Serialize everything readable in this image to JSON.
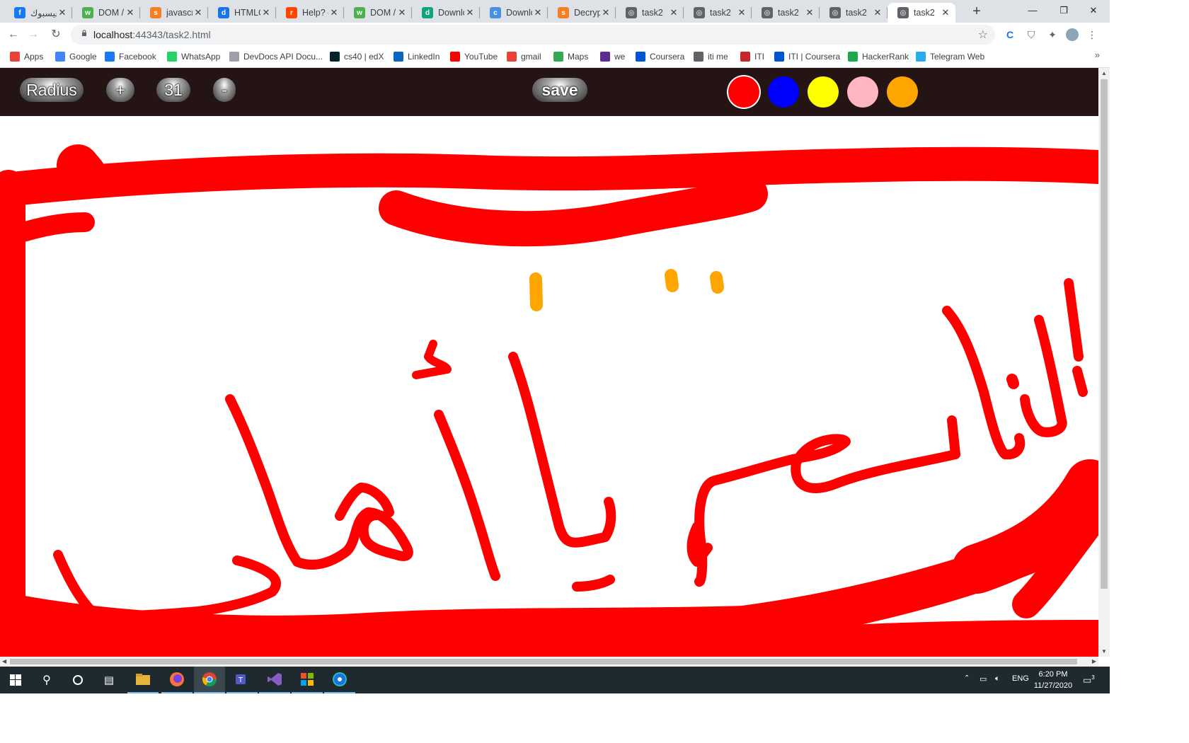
{
  "browser": {
    "tabs": [
      {
        "title": "فيسبوك",
        "icon": "facebook-icon",
        "color": "#1877f2",
        "glyph": "f"
      },
      {
        "title": "DOM /",
        "icon": "w3-icon",
        "color": "#4caf50",
        "glyph": "w"
      },
      {
        "title": "javascri",
        "icon": "stackoverflow-icon",
        "color": "#f48024",
        "glyph": "s"
      },
      {
        "title": "HTMLC",
        "icon": "devdocs-icon",
        "color": "#1a73e8",
        "glyph": "d"
      },
      {
        "title": "Help? c",
        "icon": "reddit-icon",
        "color": "#ff4500",
        "glyph": "r"
      },
      {
        "title": "DOM /",
        "icon": "w3-icon",
        "color": "#4caf50",
        "glyph": "w"
      },
      {
        "title": "Downlo",
        "icon": "download-icon",
        "color": "#10a37f",
        "glyph": "d"
      },
      {
        "title": "Downlo",
        "icon": "cloud-icon",
        "color": "#4a90e2",
        "glyph": "c"
      },
      {
        "title": "Decryp",
        "icon": "stackoverflow-icon",
        "color": "#f48024",
        "glyph": "s"
      },
      {
        "title": "task2",
        "icon": "globe-icon",
        "color": "#5f6368",
        "glyph": "◎"
      },
      {
        "title": "task2",
        "icon": "globe-icon",
        "color": "#5f6368",
        "glyph": "◎"
      },
      {
        "title": "task2",
        "icon": "globe-icon",
        "color": "#5f6368",
        "glyph": "◎"
      },
      {
        "title": "task2",
        "icon": "globe-icon",
        "color": "#5f6368",
        "glyph": "◎"
      },
      {
        "title": "task2",
        "icon": "globe-icon",
        "color": "#5f6368",
        "glyph": "◎",
        "active": true
      }
    ],
    "url_host": "localhost",
    "url_rest": ":44343/task2.html",
    "bookmarks": [
      {
        "label": "Apps",
        "icon": "apps-grid-icon",
        "color": "#ea4335"
      },
      {
        "label": "Google",
        "icon": "google-icon",
        "color": "#4285f4"
      },
      {
        "label": "Facebook",
        "icon": "facebook-icon",
        "color": "#1877f2"
      },
      {
        "label": "WhatsApp",
        "icon": "whatsapp-icon",
        "color": "#25d366"
      },
      {
        "label": "DevDocs API Docu...",
        "icon": "devdocs-icon",
        "color": "#9aa0a6"
      },
      {
        "label": "cs40 | edX",
        "icon": "edx-icon",
        "color": "#02262b"
      },
      {
        "label": "LinkedIn",
        "icon": "linkedin-icon",
        "color": "#0a66c2"
      },
      {
        "label": "YouTube",
        "icon": "youtube-icon",
        "color": "#ff0000"
      },
      {
        "label": "gmail",
        "icon": "gmail-icon",
        "color": "#ea4335"
      },
      {
        "label": "Maps",
        "icon": "maps-icon",
        "color": "#34a853"
      },
      {
        "label": "we",
        "icon": "we-icon",
        "color": "#5c2d91"
      },
      {
        "label": "Coursera",
        "icon": "coursera-icon",
        "color": "#0056d2"
      },
      {
        "label": "iti me",
        "icon": "globe-icon",
        "color": "#5f6368"
      },
      {
        "label": "ITI",
        "icon": "iti-icon",
        "color": "#c62828"
      },
      {
        "label": "ITI | Coursera",
        "icon": "coursera-icon",
        "color": "#0056d2"
      },
      {
        "label": "HackerRank",
        "icon": "hackerrank-icon",
        "color": "#1ba94c"
      },
      {
        "label": "Telegram Web",
        "icon": "telegram-icon",
        "color": "#2aabee"
      }
    ]
  },
  "app": {
    "radius_label": "Radius",
    "plus_label": "+",
    "radius_value": "31",
    "minus_label": "-",
    "save_label": "save",
    "header_bg": "#251414",
    "colors": [
      {
        "name": "red",
        "hex": "#ff0000",
        "selected": true
      },
      {
        "name": "blue",
        "hex": "#0000ff"
      },
      {
        "name": "yellow",
        "hex": "#ffff00"
      },
      {
        "name": "pink",
        "hex": "#ffb6c1"
      },
      {
        "name": "orange",
        "hex": "#ffa500"
      }
    ],
    "stroke_color": "#ff0000",
    "accent_stroke_color": "#ffa500"
  },
  "taskbar": {
    "apps": [
      "windows-start-icon",
      "search-icon",
      "cortana-icon",
      "task-view-icon",
      "file-explorer-icon",
      "firefox-icon",
      "chrome-icon",
      "teams-icon",
      "visual-studio-icon",
      "office-icon",
      "vs-code-insiders-icon"
    ],
    "language": "ENG",
    "time": "6:20 PM",
    "date": "11/27/2020",
    "notifications": "3"
  }
}
